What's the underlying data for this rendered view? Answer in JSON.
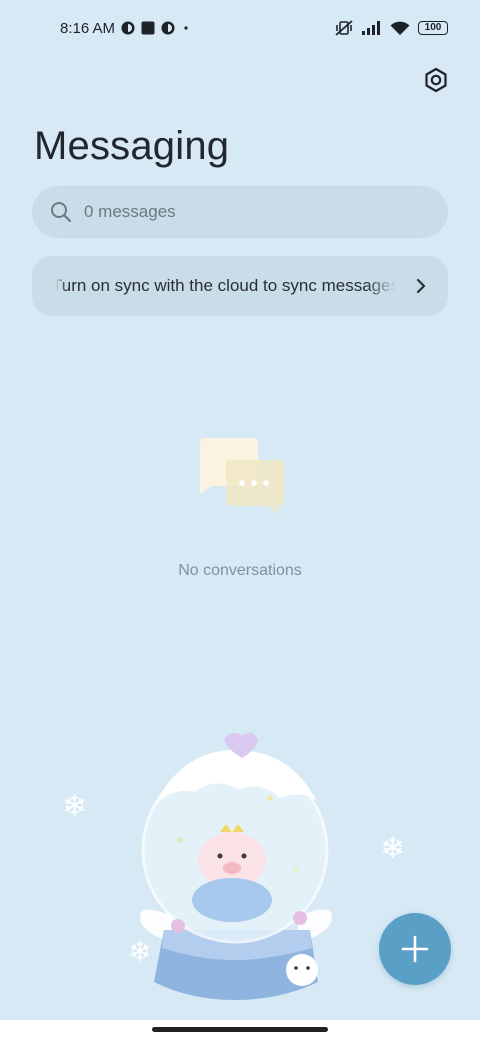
{
  "status_bar": {
    "time": "8:16 AM",
    "left_icons": [
      "app-notification-icon",
      "square-notification-icon",
      "app-notification-icon",
      "dot-icon"
    ],
    "right_icons": [
      "mute-vibrate-icon",
      "signal-icon",
      "wifi-icon"
    ],
    "battery": "100"
  },
  "header": {
    "title": "Messaging",
    "settings_icon": "settings-icon"
  },
  "search": {
    "placeholder": "0 messages",
    "icon": "search-icon"
  },
  "sync_banner": {
    "text": "Turn on sync with the cloud to sync messages",
    "icon": "chevron-right-icon"
  },
  "empty_state": {
    "text": "No conversations",
    "icon": "chat-bubbles-icon"
  },
  "fab": {
    "icon": "plus-icon"
  },
  "colors": {
    "background": "#d6e9f4",
    "card": "#c9dde8",
    "accent": "#5a9fc6"
  }
}
